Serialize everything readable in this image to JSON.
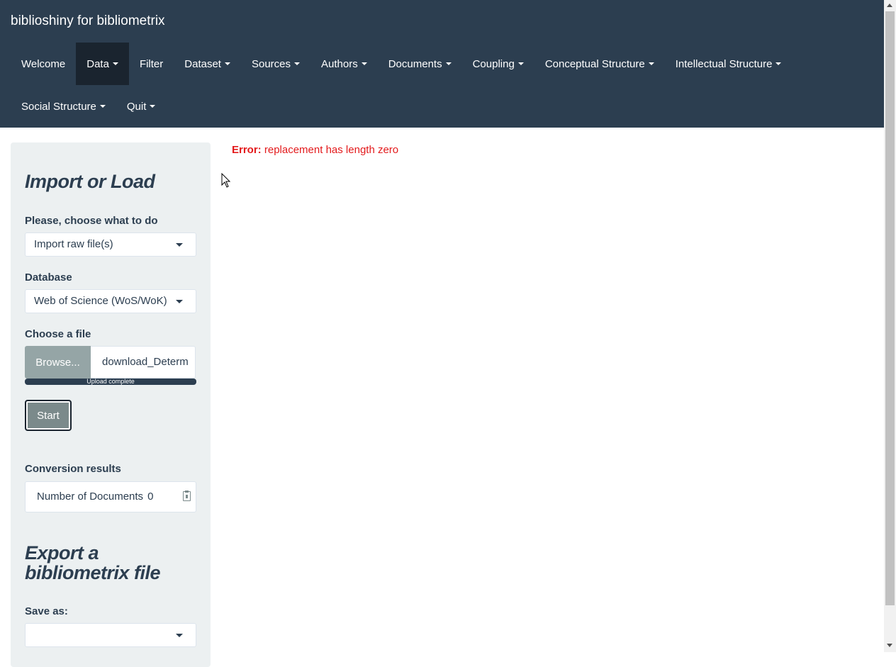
{
  "app": {
    "title": "biblioshiny for bibliometrix"
  },
  "nav": {
    "row1": [
      {
        "label": "Welcome",
        "dropdown": false
      },
      {
        "label": "Data",
        "dropdown": true
      },
      {
        "label": "Filter",
        "dropdown": false
      },
      {
        "label": "Dataset",
        "dropdown": true
      },
      {
        "label": "Sources",
        "dropdown": true
      },
      {
        "label": "Authors",
        "dropdown": true
      },
      {
        "label": "Documents",
        "dropdown": true
      },
      {
        "label": "Coupling",
        "dropdown": true
      },
      {
        "label": "Conceptual Structure",
        "dropdown": true
      },
      {
        "label": "Intellectual Structure",
        "dropdown": true
      }
    ],
    "row2": [
      {
        "label": "Social Structure",
        "dropdown": true
      },
      {
        "label": "Quit",
        "dropdown": true
      }
    ],
    "active": "Data"
  },
  "sidebar": {
    "import_heading": "Import or Load",
    "choose_label": "Please, choose what to do",
    "choose_value": "Import raw file(s)",
    "database_label": "Database",
    "database_value": "Web of Science (WoS/WoK)",
    "file_label": "Choose a file",
    "browse_label": "Browse...",
    "file_value": "download_Determ",
    "upload_status": "Upload complete",
    "upload_progress_percent": 100,
    "start_label": "Start",
    "conversion_label": "Conversion results",
    "num_docs_label": "Number of Documents",
    "num_docs_value": "0",
    "export_heading": "Export a bibliometrix file",
    "save_as_label": "Save as:",
    "save_as_value": ""
  },
  "main": {
    "error_label": "Error:",
    "error_message": "replacement has length zero"
  },
  "colors": {
    "navbar": "#2c3e50",
    "nav_active": "#1a242f",
    "sidebar_bg": "#ecf0f1",
    "error": "#e31a1c",
    "browse_btn": "#95a5a6",
    "start_btn": "#7b8a8b"
  }
}
